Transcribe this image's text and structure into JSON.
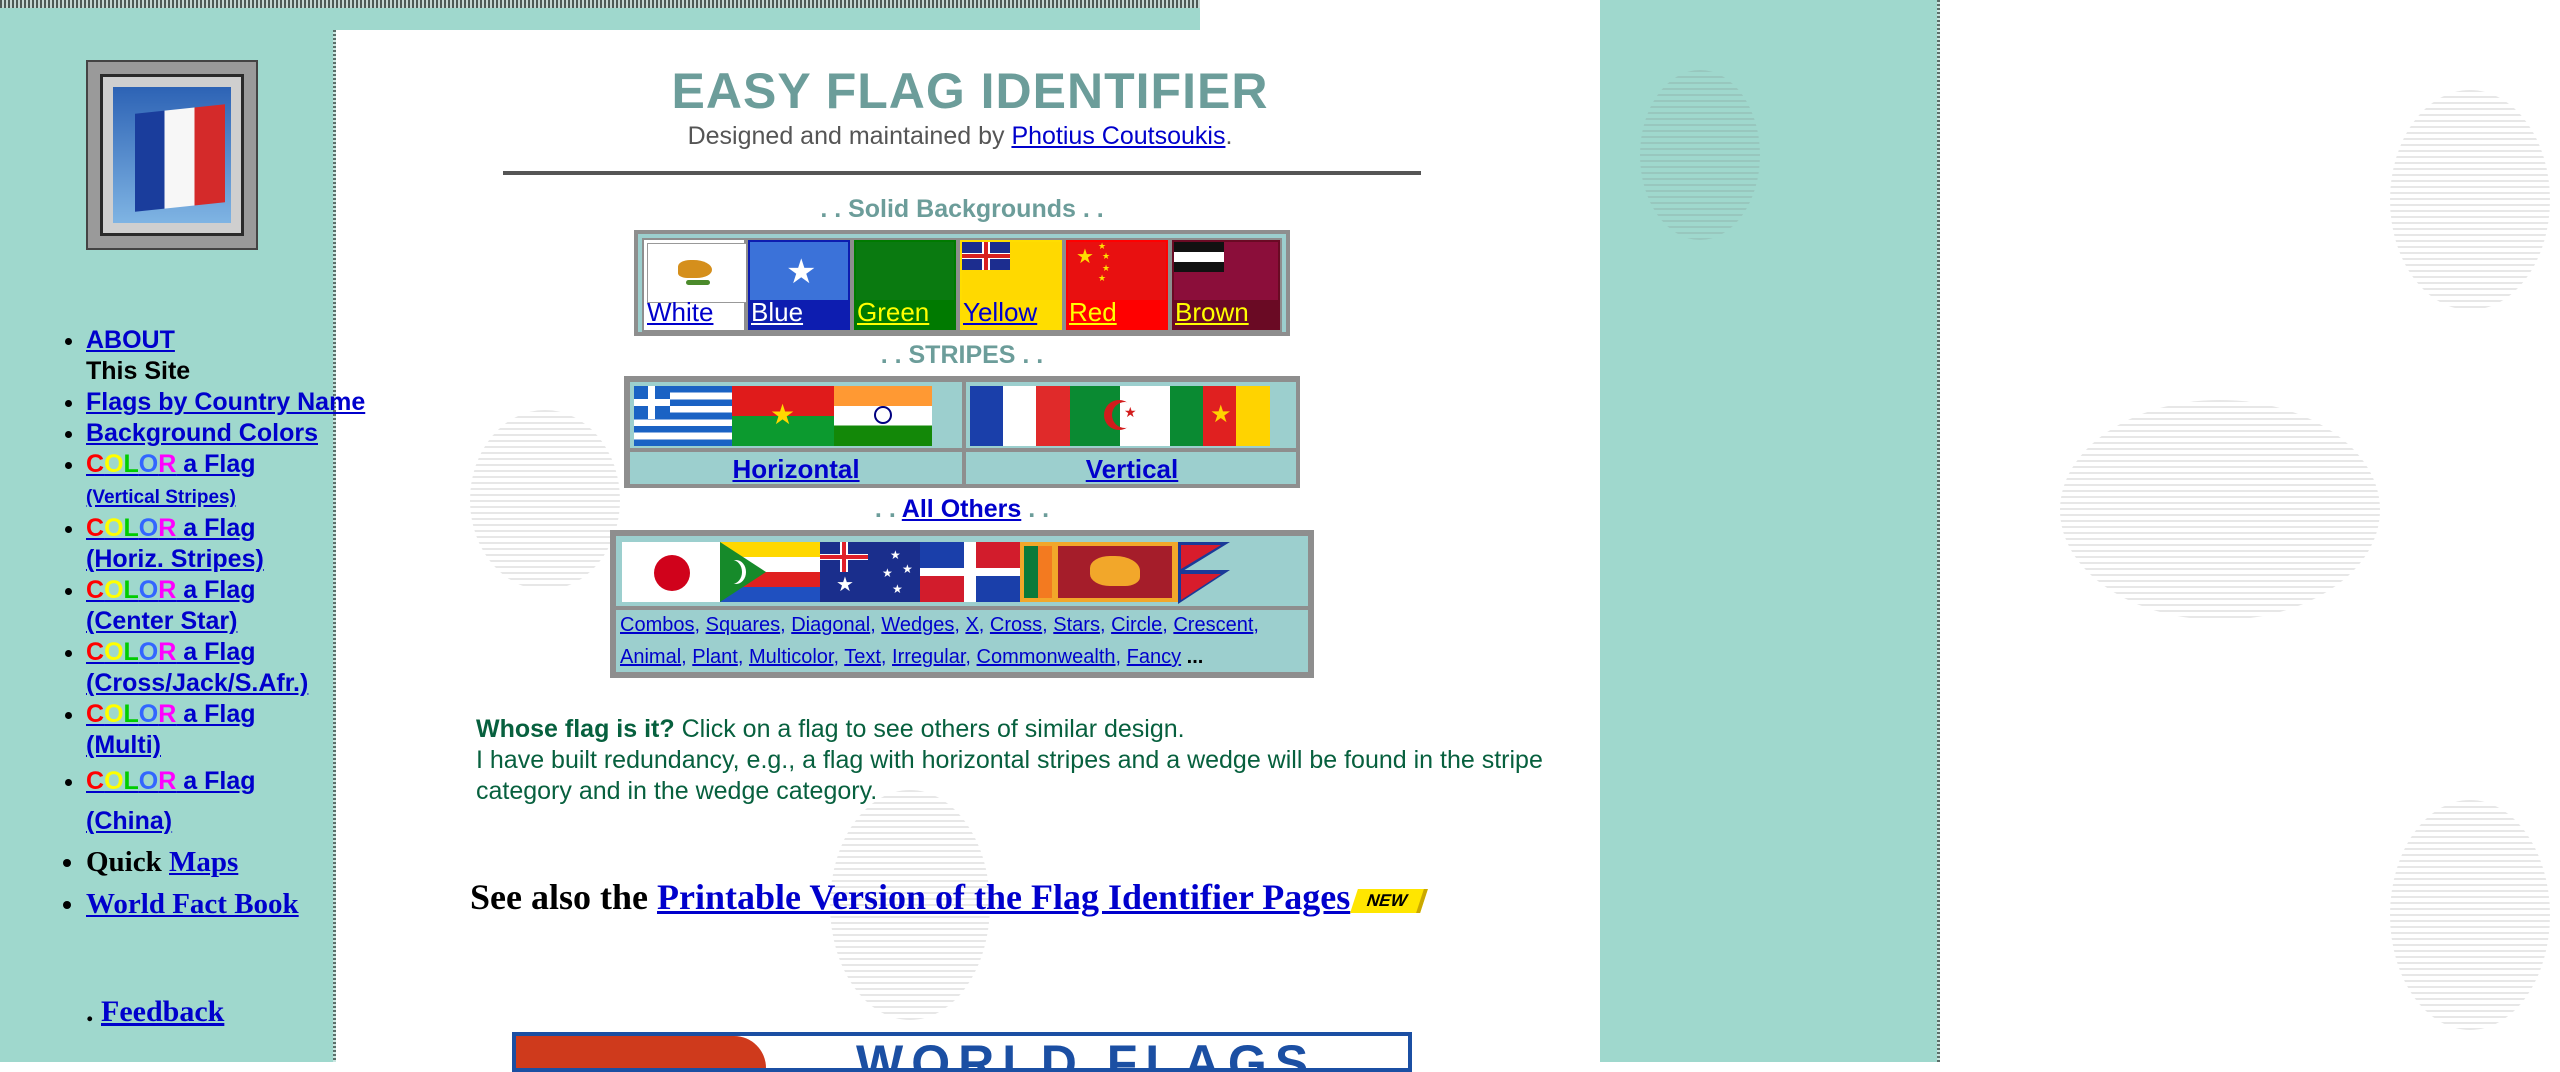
{
  "page": {
    "title": "EASY FLAG IDENTIFIER",
    "byline_prefix": "Designed and maintained by",
    "author": "Photius Coutsoukis",
    "byline_suffix": "."
  },
  "colors": {
    "band": "#9fd8cd",
    "title": "#6c9d9a",
    "link": "#0000cc",
    "body_text": "#07603e",
    "table_bg": "#9ccfce"
  },
  "sidebar": {
    "logo_icon": "france-flag-icon",
    "items": [
      {
        "link": "ABOUT",
        "text": "This Site"
      },
      {
        "link": "Flags by Country Name"
      },
      {
        "link": "Background Colors"
      },
      {
        "rainbow": [
          "C",
          "O",
          "L",
          "O",
          "R"
        ],
        "link": " a Flag",
        "sub": "(Vertical Stripes)"
      },
      {
        "rainbow": [
          "C",
          "O",
          "L",
          "O",
          "R"
        ],
        "link": " a Flag",
        "sub": "(Horiz. Stripes)"
      },
      {
        "rainbow": [
          "C",
          "O",
          "L",
          "O",
          "R"
        ],
        "link": " a Flag",
        "sub": "(Center Star)"
      },
      {
        "rainbow": [
          "C",
          "O",
          "L",
          "O",
          "R"
        ],
        "link": " a Flag",
        "sub": "(Cross/Jack/S.Afr.)"
      },
      {
        "rainbow": [
          "C",
          "O",
          "L",
          "O",
          "R"
        ],
        "link": " a Flag",
        "sub": "(Multi)"
      },
      {
        "rainbow": [
          "C",
          "O",
          "L",
          "O",
          "R"
        ],
        "link": " a Flag",
        "sub": "(China)"
      },
      {
        "text": "Quick",
        "link": "Maps"
      },
      {
        "link": "World Fact Book"
      }
    ],
    "feedback_prefix": ".",
    "feedback": "Feedback"
  },
  "solid": {
    "heading": ". . Solid Backgrounds . .",
    "items": [
      {
        "label": "White",
        "bg": "#ffffff",
        "label_color": "#0000cc",
        "flag": "cyprus-flag-icon"
      },
      {
        "label": "Blue",
        "bg": "#0033cc",
        "label_color": "#ffffff",
        "flag": "somalia-flag-icon"
      },
      {
        "label": "Green",
        "bg": "#007a00",
        "label_color": "#ffff00",
        "flag": "green-flag-icon"
      },
      {
        "label": "Yellow",
        "bg": "#ffdd00",
        "label_color": "#0000cc",
        "flag": "yellow-ensign-flag-icon"
      },
      {
        "label": "Red",
        "bg": "#ff0000",
        "label_color": "#ffff00",
        "flag": "china-flag-icon"
      },
      {
        "label": "Brown",
        "bg": "#7a0f2a",
        "label_color": "#ffff00",
        "flag": "brown-flag-icon"
      }
    ]
  },
  "stripes": {
    "heading": ". . STRIPES . .",
    "horizontal": "Horizontal",
    "vertical": "Vertical"
  },
  "others": {
    "heading_prefix": ". .",
    "heading_link": "All Others",
    "heading_suffix": ". .",
    "links_line1": [
      "Combos",
      "Squares",
      "Diagonal",
      "Wedges",
      "X",
      "Cross",
      "Stars",
      "Circle",
      "Crescent"
    ],
    "links_line2": [
      "Animal",
      "Plant",
      "Multicolor",
      "Text",
      "Irregular",
      "Commonwealth",
      "Fancy"
    ],
    "ellipsis": "..."
  },
  "whose": {
    "lead": "Whose flag is it?",
    "line1": " Click on a flag to see others of similar design.",
    "line2": "I have built redundancy, e.g., a flag with horizontal stripes and a wedge will be found in the stripe category and in the wedge category."
  },
  "see_also": {
    "prefix": "See also the",
    "link": "Printable Version of the Flag Identifier Pages",
    "badge": "NEW"
  },
  "banner": {
    "text": "WORLD FLAGS"
  }
}
